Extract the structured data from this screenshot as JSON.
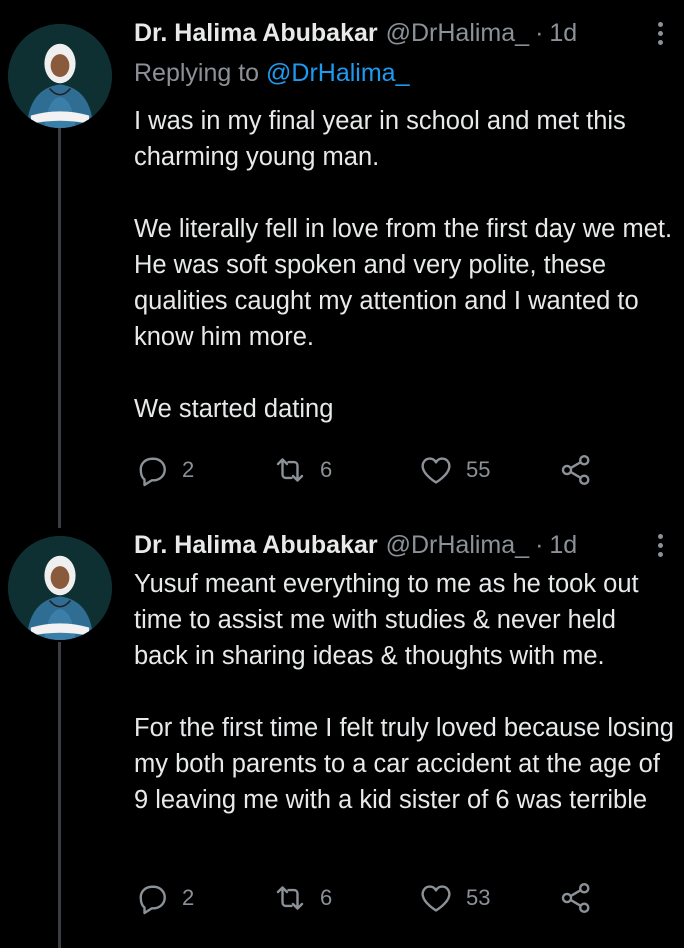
{
  "tweets": [
    {
      "author_name": "Dr. Halima Abubakar",
      "handle": "@DrHalima_",
      "separator": "·",
      "time": "1d",
      "replying_label": "Replying to",
      "replying_to": "@DrHalima_",
      "paragraphs": [
        "I was in my final year in school and met this charming young man.",
        "We literally fell in love from the first day we met. He was soft spoken and very polite, these qualities caught my attention and I wanted to know him more.",
        "We started dating"
      ],
      "replies": "2",
      "retweets": "6",
      "likes": "55"
    },
    {
      "author_name": "Dr. Halima Abubakar",
      "handle": "@DrHalima_",
      "separator": "·",
      "time": "1d",
      "paragraphs": [
        "Yusuf meant everything to me as he took out time to assist me with studies & never held back in sharing ideas & thoughts with me.",
        "For the first time I felt truly loved because losing my both parents to a car accident at the age of 9 leaving me with a kid sister of 6 was terrible"
      ],
      "replies": "2",
      "retweets": "6",
      "likes": "53"
    }
  ],
  "icons": {
    "reply": "reply-icon",
    "retweet": "retweet-icon",
    "like": "heart-icon",
    "share": "share-icon",
    "more": "more-options-icon"
  },
  "colors": {
    "background": "#000000",
    "text": "#e7e9ea",
    "secondary": "#8b9197",
    "link": "#1d9bf0",
    "thread_line": "#3a3d41"
  }
}
